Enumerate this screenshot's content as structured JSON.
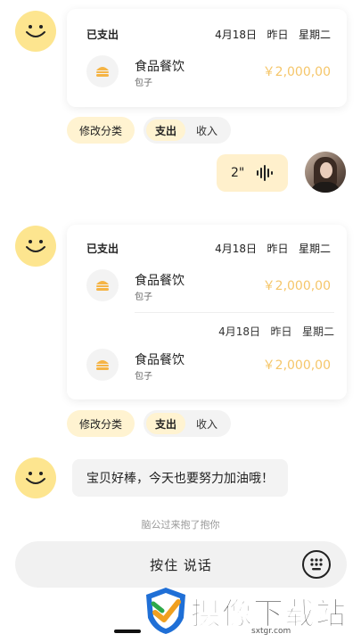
{
  "colors": {
    "accent_yellow": "#fde58f",
    "amount_yellow": "#f5c66a",
    "chip_bg": "#fff3d1"
  },
  "messages": [
    {
      "type": "bill_card",
      "status": "已支出",
      "date": "4月18日",
      "day": "昨日",
      "weekday": "星期二",
      "entries": [
        {
          "category": "食品餐饮",
          "note": "包子",
          "amount": "￥2,000,00"
        }
      ],
      "edit_label": "修改分类",
      "toggle_on": "支出",
      "toggle_off": "收入"
    },
    {
      "type": "voice",
      "duration": "2\""
    },
    {
      "type": "bill_card",
      "status": "已支出",
      "date": "4月18日",
      "day": "昨日",
      "weekday": "星期二",
      "entries": [
        {
          "category": "食品餐饮",
          "note": "包子",
          "amount": "￥2,000,00"
        },
        {
          "date": "4月18日",
          "day": "昨日",
          "weekday": "星期二",
          "category": "食品餐饮",
          "note": "包子",
          "amount": "￥2,000,00"
        }
      ],
      "edit_label": "修改分类",
      "toggle_on": "支出",
      "toggle_off": "收入"
    },
    {
      "type": "text",
      "text": "宝贝好棒，今天也要努力加油哦！"
    }
  ],
  "tip": "脑公过来抱了抱你",
  "input": {
    "push_to_talk": "按住  说话",
    "keyboard_icon": "keyboard-icon"
  },
  "watermark": {
    "title": "摄像下载站",
    "url": "sxtgr.com"
  }
}
